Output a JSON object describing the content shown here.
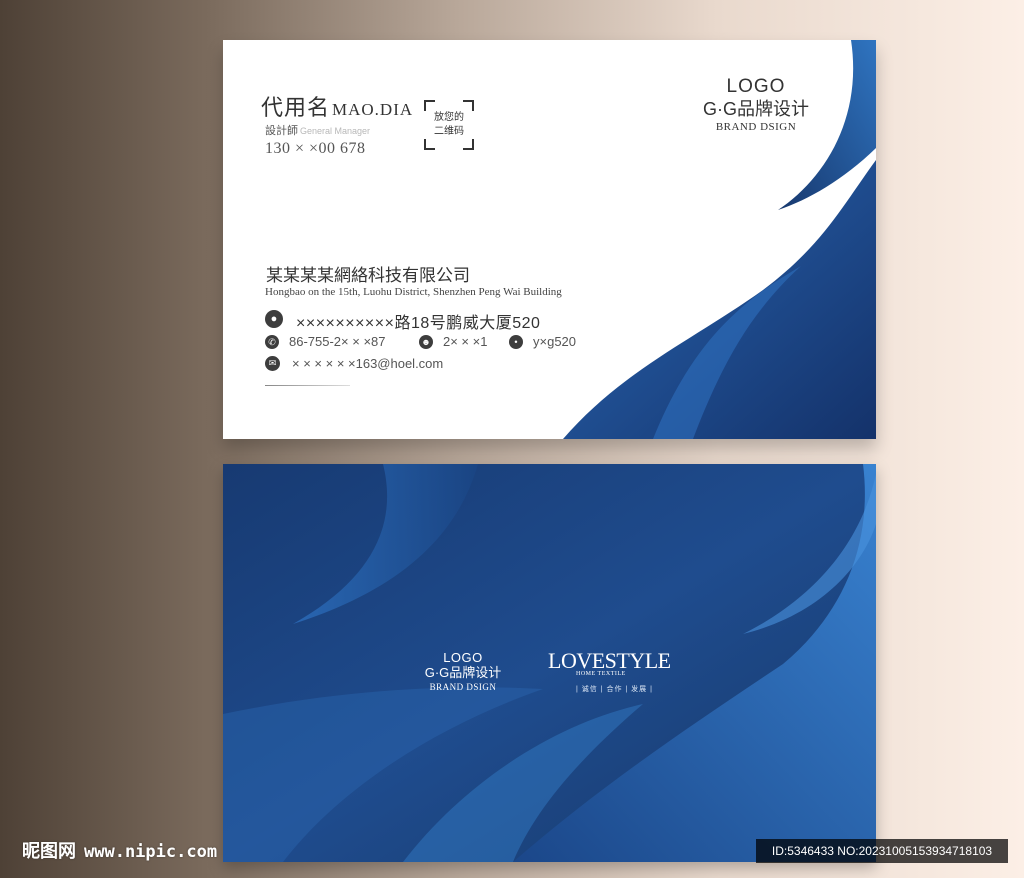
{
  "front": {
    "person": {
      "name_cn": "代用名",
      "name_en": "MAO.DIA",
      "title_cn": "設計師",
      "title_en": "General Manager",
      "mobile": "130 × ×00 678"
    },
    "qr_text": [
      "放您的",
      "二维码"
    ],
    "logo": {
      "word": "LOGO",
      "brand": "G·G品牌设计",
      "en": "BRAND DSIGN"
    },
    "company": {
      "name": "某某某某網絡科技有限公司",
      "address_en": "Hongbao on the 15th, Luohu District, Shenzhen Peng Wai Building"
    },
    "contacts": {
      "address": "××××××××××路18号鹏威大厦520",
      "phone": "86-755-2× × ×87",
      "qq": "2× × ×1",
      "wechat": "y×g520",
      "email": "× × × × × ×163@hoel.com"
    }
  },
  "back": {
    "logo": {
      "word": "LOGO",
      "brand": "G·G品牌设计",
      "en": "BRAND DSIGN"
    },
    "lovestyle": {
      "word": "LOVESTYLE",
      "sub": "HOME TEXTILE",
      "tagline": "| 诚信 | 合作 | 发展 |"
    }
  },
  "watermark": {
    "brand": "昵图网",
    "site": "www.nipic.com",
    "image_id": "ID:5346433 NO:20231005153934718103"
  },
  "colors": {
    "blue_dark": "#17386e",
    "blue_mid": "#1f4c8e",
    "blue_light": "#2f74c0"
  },
  "icons": {
    "address": "location-pin-icon",
    "phone": "phone-icon",
    "qq": "qq-penguin-icon",
    "wechat": "wechat-icon",
    "email": "envelope-icon"
  }
}
